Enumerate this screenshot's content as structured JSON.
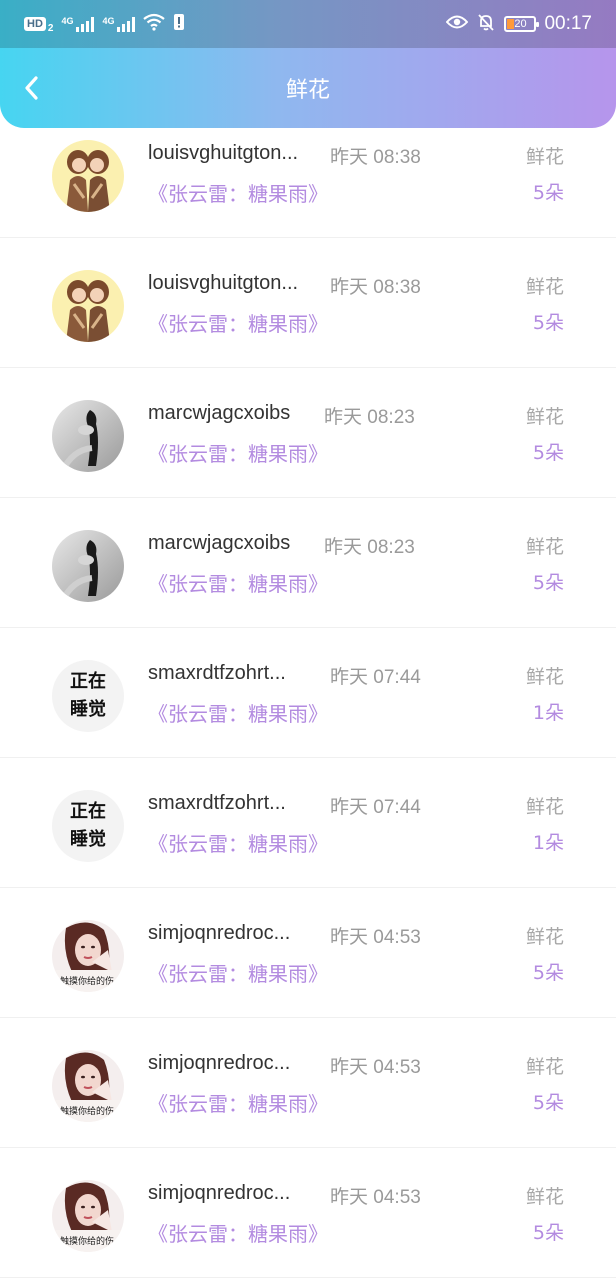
{
  "status_bar": {
    "hd": "HD",
    "sim1": "2",
    "net1": "4G",
    "net2": "4G",
    "battery": "20",
    "time": "00:17"
  },
  "header": {
    "title": "鲜花",
    "back_icon": "chevron-left-icon"
  },
  "records": [
    {
      "user": "louisvghuitgton...",
      "time": "昨天 08:38",
      "song": "《张云雷：糖果雨》",
      "gift": "鲜花",
      "count": "5朵",
      "avatar": "anime-girls"
    },
    {
      "user": "louisvghuitgton...",
      "time": "昨天 08:38",
      "song": "《张云雷：糖果雨》",
      "gift": "鲜花",
      "count": "5朵",
      "avatar": "anime-girls"
    },
    {
      "user": "marcwjagcxoibs",
      "time": "昨天 08:23",
      "song": "《张云雷：糖果雨》",
      "gift": "鲜花",
      "count": "5朵",
      "avatar": "bw-photo"
    },
    {
      "user": "marcwjagcxoibs",
      "time": "昨天 08:23",
      "song": "《张云雷：糖果雨》",
      "gift": "鲜花",
      "count": "5朵",
      "avatar": "bw-photo"
    },
    {
      "user": "smaxrdtfzohrt...",
      "time": "昨天 07:44",
      "song": "《张云雷：糖果雨》",
      "gift": "鲜花",
      "count": "1朵",
      "avatar": "text",
      "avatar_text_1": "正在",
      "avatar_text_2": "睡觉"
    },
    {
      "user": "smaxrdtfzohrt...",
      "time": "昨天 07:44",
      "song": "《张云雷：糖果雨》",
      "gift": "鲜花",
      "count": "1朵",
      "avatar": "text",
      "avatar_text_1": "正在",
      "avatar_text_2": "睡觉"
    },
    {
      "user": "simjoqnredroc...",
      "time": "昨天 04:53",
      "song": "《张云雷：糖果雨》",
      "gift": "鲜花",
      "count": "5朵",
      "avatar": "portrait",
      "avatar_caption": "触摸你给的伤"
    },
    {
      "user": "simjoqnredroc...",
      "time": "昨天 04:53",
      "song": "《张云雷：糖果雨》",
      "gift": "鲜花",
      "count": "5朵",
      "avatar": "portrait",
      "avatar_caption": "触摸你给的伤"
    },
    {
      "user": "simjoqnredroc...",
      "time": "昨天 04:53",
      "song": "《张云雷：糖果雨》",
      "gift": "鲜花",
      "count": "5朵",
      "avatar": "portrait",
      "avatar_caption": "触摸你给的伤"
    }
  ]
}
